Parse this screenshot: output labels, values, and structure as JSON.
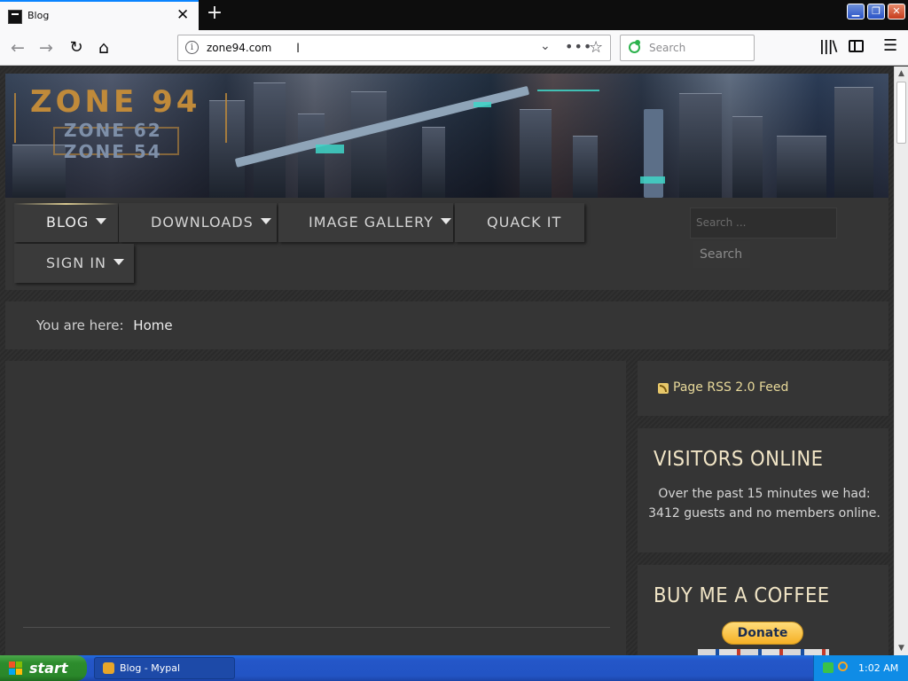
{
  "browser": {
    "tab_title": "Blog",
    "tab_close": "✕",
    "new_tab": "+",
    "url": "zone94.com",
    "search_placeholder": "Search",
    "window_controls": {
      "minimize": "▁",
      "maximize": "❐",
      "close": "✕"
    },
    "icons": [
      "back-arrow-icon",
      "forward-arrow-icon",
      "reload-icon",
      "home-icon",
      "info-icon",
      "dropdown-icon",
      "page-actions-icon",
      "bookmark-star-icon",
      "library-icon",
      "sidebar-icon",
      "hamburger-menu-icon"
    ]
  },
  "site": {
    "logo": {
      "main": "ZONE 94",
      "line1": "ZONE 62",
      "line2": "ZONE 54"
    },
    "nav": {
      "blog": "BLOG",
      "downloads": "DOWNLOADS",
      "image_gallery": "IMAGE GALLERY",
      "quack_it": "QUACK IT",
      "sign_in": "SIGN IN"
    },
    "search_placeholder": "Search ...",
    "search_button": "Search",
    "breadcrumb": {
      "prefix": "You are here:",
      "current": "Home"
    },
    "rss": {
      "label": "Page RSS 2.0 Feed"
    },
    "visitors": {
      "title": "VISITORS ONLINE",
      "body": "Over the past 15 minutes we had: 3412 guests and no members online."
    },
    "coffee": {
      "title": "BUY ME A COFFEE",
      "donate": "Donate"
    },
    "accent_color": "#f1e5c6",
    "rss_color": "#e8d99a"
  },
  "taskbar": {
    "start": "start",
    "task": "Blog - Mypal",
    "clock": "1:02 AM"
  }
}
